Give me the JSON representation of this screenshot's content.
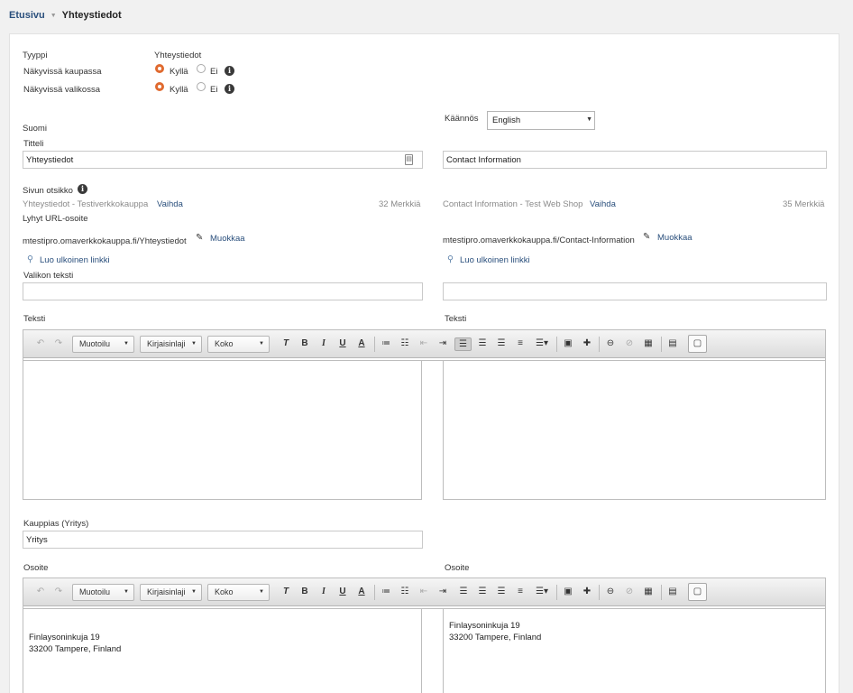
{
  "breadcrumb": {
    "home": "Etusivu",
    "current": "Yhteystiedot"
  },
  "type": {
    "label": "Tyyppi",
    "value": "Yhteystiedot"
  },
  "visibility": [
    {
      "label": "Näkyvissä kaupassa",
      "yes": "Kyllä",
      "no": "Ei",
      "selected": "yes"
    },
    {
      "label": "Näkyvissä valikossa",
      "yes": "Kyllä",
      "no": "Ei",
      "selected": "yes"
    }
  ],
  "left": {
    "language": "Suomi",
    "title_label": "Titteli",
    "title_value": "Yhteystiedot",
    "page_title_label": "Sivun otsikko",
    "page_title_preview": "Yhteystiedot - Testiverkkokauppa",
    "change_link": "Vaihda",
    "char_count": "32 Merkkiä",
    "short_url_label": "Lyhyt URL-osoite",
    "url": "mtestipro.omaverkkokauppa.fi/Yhteystiedot",
    "edit_link": "Muokkaa",
    "external_link": "Luo ulkoinen linkki",
    "menu_text_label": "Valikon teksti",
    "menu_text_value": "",
    "text_label": "Teksti",
    "merchant_label": "Kauppias (Yritys)",
    "merchant_value": "Yritys",
    "address_label": "Osoite",
    "address_lines": [
      "Finlaysoninkuja 19",
      "33200 Tampere, Finland"
    ]
  },
  "right": {
    "translation_label": "Käännös",
    "translation_value": "English",
    "title_value": "Contact Information",
    "page_title_preview": "Contact Information - Test Web Shop",
    "change_link": "Vaihda",
    "char_count": "35 Merkkiä",
    "url": "mtestipro.omaverkkokauppa.fi/Contact-Information",
    "edit_link": "Muokkaa",
    "external_link": "Luo ulkoinen linkki",
    "menu_text_value": "",
    "text_label": "Teksti",
    "address_label": "Osoite",
    "address_lines": [
      "Finlaysoninkuja 19",
      "33200 Tampere, Finland"
    ]
  },
  "toolbar": {
    "format": "Muotoilu",
    "font": "Kirjaisinlaji",
    "size": "Koko"
  },
  "colors": {
    "accent": "#e06a2f",
    "link": "#2a4f7c"
  }
}
